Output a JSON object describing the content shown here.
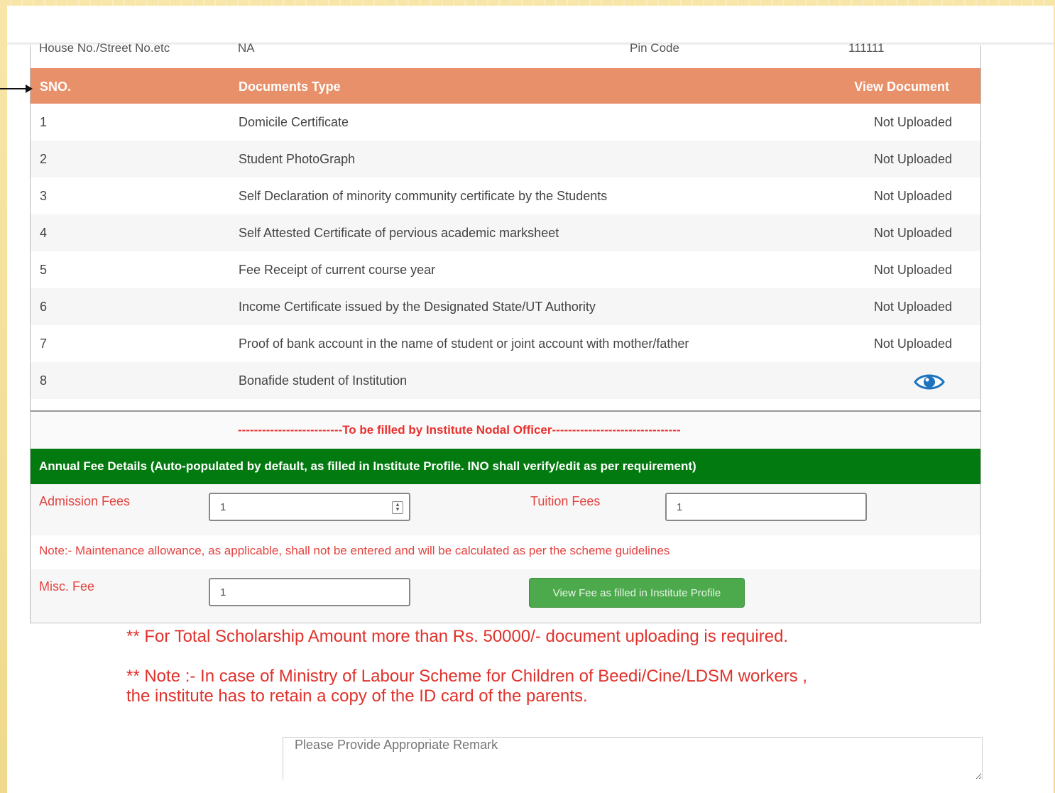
{
  "address": {
    "house_label": "House No./Street No.etc",
    "house_value": "NA",
    "pin_label": "Pin Code",
    "pin_value": "111111"
  },
  "documents": {
    "headers": {
      "sno": "SNO.",
      "type": "Documents Type",
      "view": "View Document"
    },
    "rows": [
      {
        "sno": "1",
        "type": "Domicile Certificate",
        "status": "Not Uploaded"
      },
      {
        "sno": "2",
        "type": "Student PhotoGraph",
        "status": "Not Uploaded"
      },
      {
        "sno": "3",
        "type": "Self Declaration of minority community certificate by the Students",
        "status": "Not Uploaded"
      },
      {
        "sno": "4",
        "type": "Self Attested Certificate of pervious academic marksheet",
        "status": "Not Uploaded"
      },
      {
        "sno": "5",
        "type": "Fee Receipt of current course year",
        "status": "Not Uploaded"
      },
      {
        "sno": "6",
        "type": "Income Certificate issued by the Designated State/UT Authority",
        "status": "Not Uploaded"
      },
      {
        "sno": "7",
        "type": "Proof of bank account in the name of student or joint account with mother/father",
        "status": "Not Uploaded"
      },
      {
        "sno": "8",
        "type": "Bonafide student of Institution",
        "status": "",
        "icon": "eye-icon"
      }
    ]
  },
  "nodal_text": "--------------------------To be filled by Institute Nodal Officer--------------------------------",
  "fees": {
    "header": "Annual Fee Details (Auto-populated by default, as filled in Institute Profile. INO shall verify/edit as per requirement)",
    "admission_label": "Admission Fees",
    "admission_value": "1",
    "tuition_label": "Tuition Fees",
    "tuition_value": "1",
    "note": "Note:- Maintenance allowance, as applicable, shall not be entered and will be calculated as per the scheme guidelines",
    "misc_label": "Misc. Fee",
    "misc_value": "1",
    "view_button": "View Fee as filled in Institute Profile"
  },
  "notes": {
    "scholarship": "** For Total Scholarship Amount more than Rs. 50000/- document uploading is required.",
    "labour_line1": "** Note :- In case of Ministry of Labour Scheme for Children of Beedi/Cine/LDSM workers ,",
    "labour_line2": "the institute has to retain a copy of the ID card of the parents."
  },
  "remark": {
    "placeholder": "Please Provide Appropriate Remark"
  },
  "colors": {
    "table_header": "#e8906a",
    "fee_header": "#037a10",
    "button": "#4caa4c",
    "note_red": "#e0312b"
  }
}
